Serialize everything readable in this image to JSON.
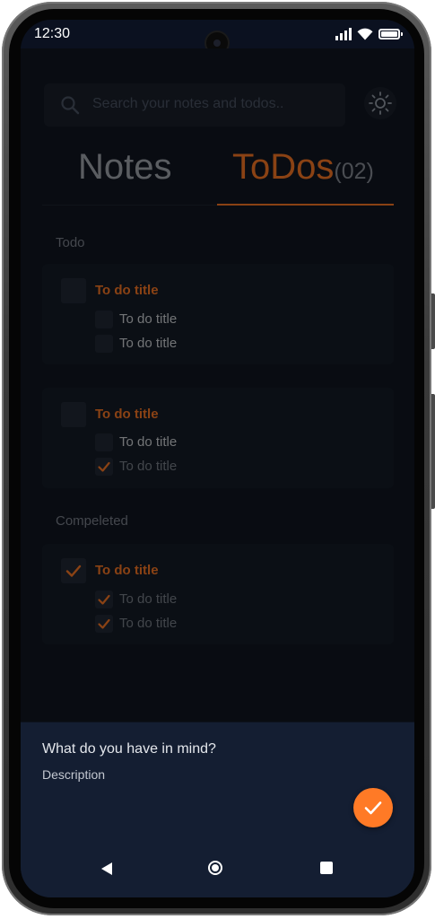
{
  "status_bar": {
    "time": "12:30",
    "icons": [
      "signal-icon",
      "wifi-icon",
      "battery-icon"
    ]
  },
  "search": {
    "placeholder": "Search your notes and todos.."
  },
  "theme_toggle": {
    "icon": "sun-icon"
  },
  "tabs": {
    "notes_label": "Notes",
    "todos_label": "ToDos",
    "todos_count": "(02)",
    "active": "ToDos"
  },
  "sections": {
    "todo_label": "Todo",
    "completed_label": "Compeleted"
  },
  "todo_cards": [
    {
      "title": "To do title",
      "checked": false,
      "items": [
        {
          "label": "To do title",
          "checked": false
        },
        {
          "label": "To do title",
          "checked": false
        }
      ]
    },
    {
      "title": "To do title",
      "checked": false,
      "items": [
        {
          "label": "To do title",
          "checked": false
        },
        {
          "label": "To do title",
          "checked": true
        }
      ]
    }
  ],
  "completed_cards": [
    {
      "title": "To do title",
      "checked": true,
      "items": [
        {
          "label": "To do title",
          "checked": true
        },
        {
          "label": "To do title",
          "checked": true
        }
      ]
    }
  ],
  "sheet": {
    "title": "What do you have in mind?",
    "description": "Description",
    "submit_icon": "check-icon"
  },
  "nav": {
    "back_icon": "back-icon",
    "home_icon": "home-icon",
    "recents_icon": "recents-icon"
  },
  "colors": {
    "accent": "#ff7a26",
    "background": "#111722",
    "sheet": "#141e32",
    "card": "#161d28"
  }
}
